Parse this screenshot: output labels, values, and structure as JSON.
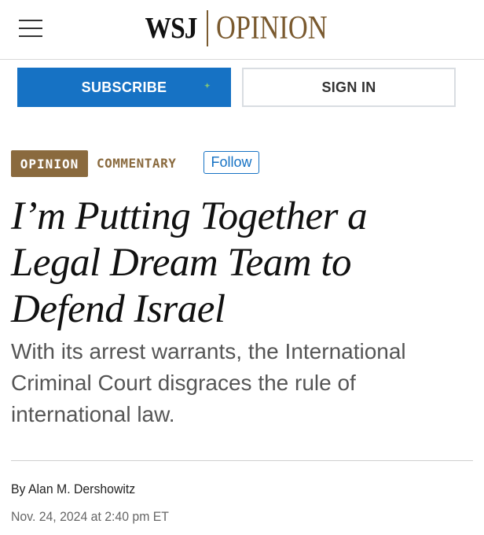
{
  "header": {
    "brand_primary": "WSJ",
    "brand_secondary": "OPINION",
    "menu_icon": "hamburger-menu-icon"
  },
  "actions": {
    "subscribe_label": "SUBSCRIBE",
    "signin_label": "SIGN IN"
  },
  "article": {
    "section_tag": "OPINION",
    "category": "COMMENTARY",
    "follow_label": "Follow",
    "headline_lines": [
      "I’m Putting Together a",
      "Legal Dream Team to",
      "Defend Israel"
    ],
    "dek": "With its arrest warrants, the International Criminal Court disgraces the rule of international law.",
    "byline_prefix": "By",
    "author": "Alan M. Dershowitz",
    "timestamp": "Nov. 24, 2024 at 2:40 pm ET"
  },
  "colors": {
    "brand_gold": "#7a5a2f",
    "tag_bg": "#8a6a3e",
    "accent_blue": "#1672c4"
  }
}
